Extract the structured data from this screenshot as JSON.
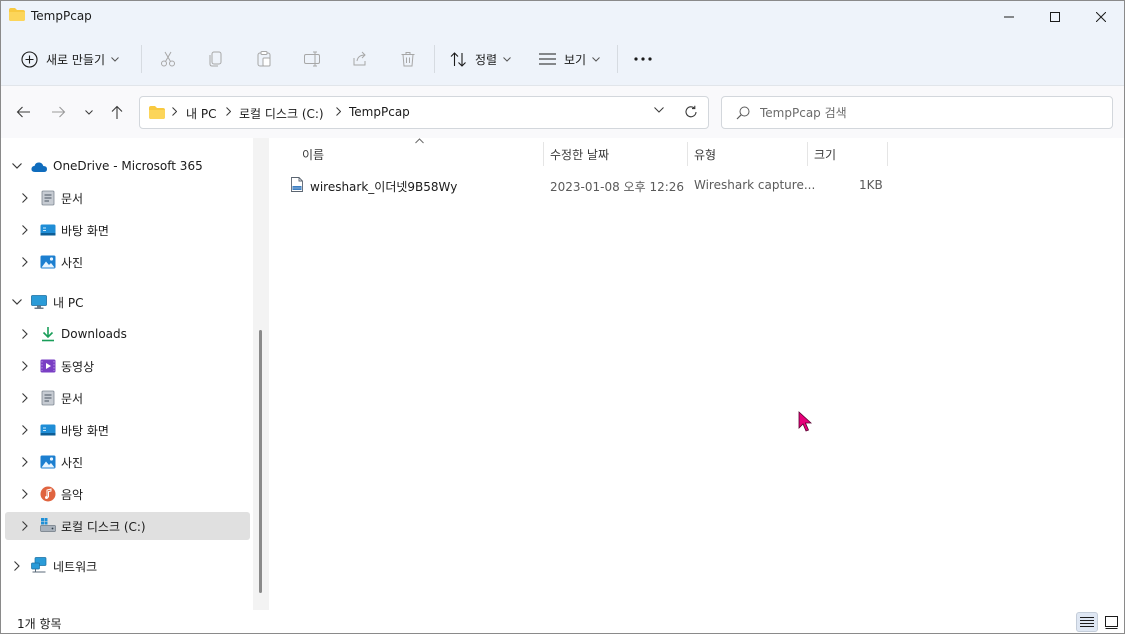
{
  "window": {
    "title": "TempPcap",
    "accent_color": "#0067c0",
    "folder_color": "#f8c940"
  },
  "toolbar": {
    "new_label": "새로 만들기",
    "sort_label": "정렬",
    "view_label": "보기",
    "more_label": "···",
    "disabled_icons": [
      "cut-icon",
      "copy-icon",
      "paste-icon",
      "rename-icon",
      "share-icon",
      "delete-icon"
    ]
  },
  "address": {
    "crumbs": [
      "내 PC",
      "로컬 디스크 (C:)",
      "TempPcap"
    ]
  },
  "search": {
    "placeholder": "TempPcap 검색"
  },
  "sidebar": {
    "onedrive": "OneDrive - Microsoft 365",
    "od_docs": "문서",
    "od_desktop": "바탕 화면",
    "od_pictures": "사진",
    "thispc": "내 PC",
    "downloads": "Downloads",
    "videos": "동영상",
    "docs": "문서",
    "desktop": "바탕 화면",
    "pictures": "사진",
    "music": "음악",
    "localdisk": "로컬 디스크 (C:)",
    "network": "네트워크"
  },
  "columns": {
    "name": "이름",
    "modified": "수정한 날짜",
    "type": "유형",
    "size": "크기"
  },
  "files": [
    {
      "name": "wireshark_이더넷9B58Wy",
      "modified": "2023-01-08 오후 12:26",
      "type": "Wireshark capture...",
      "size": "1KB"
    }
  ],
  "status": {
    "count": "1개 항목"
  }
}
